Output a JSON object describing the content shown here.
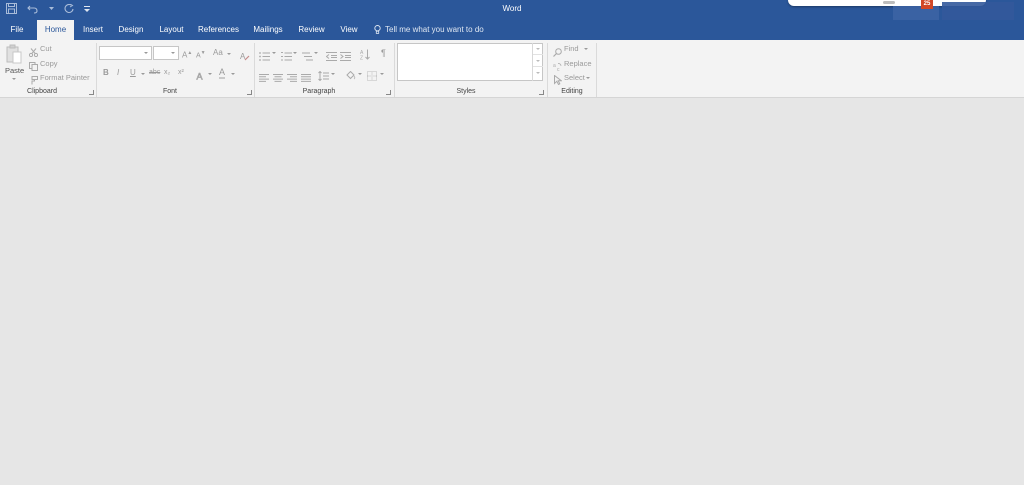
{
  "window": {
    "title": "Word",
    "notification_count": "25"
  },
  "quick_access": [
    "save-icon",
    "undo-icon",
    "redo-icon",
    "customize-icon"
  ],
  "tabs": [
    {
      "label": "File"
    },
    {
      "label": "Home"
    },
    {
      "label": "Insert"
    },
    {
      "label": "Design"
    },
    {
      "label": "Layout"
    },
    {
      "label": "References"
    },
    {
      "label": "Mailings"
    },
    {
      "label": "Review"
    },
    {
      "label": "View"
    }
  ],
  "active_tab": "Home",
  "tell_me": {
    "text": "Tell me what you want to do"
  },
  "clipboard": {
    "paste_label": "Paste",
    "cut_label": "Cut",
    "copy_label": "Copy",
    "format_painter_label": "Format Painter",
    "group_label": "Clipboard"
  },
  "font": {
    "font_name_value": "",
    "font_size_value": "",
    "group_label": "Font",
    "bold_label": "B",
    "italic_label": "I",
    "underline_label": "U",
    "strike_label": "abc",
    "subscript_label": "x₂",
    "superscript_label": "x²",
    "grow_label": "A",
    "shrink_label": "A",
    "case_label": "Aa",
    "font_color_label": "A"
  },
  "paragraph": {
    "group_label": "Paragraph"
  },
  "styles": {
    "group_label": "Styles"
  },
  "editing": {
    "find_label": "Find",
    "replace_label": "Replace",
    "select_label": "Select",
    "group_label": "Editing"
  },
  "colors": {
    "ribbon_blue": "#2b579a",
    "ribbon_bg": "#f3f3f3",
    "workspace": "#e6e6e6",
    "badge": "#d24726"
  }
}
